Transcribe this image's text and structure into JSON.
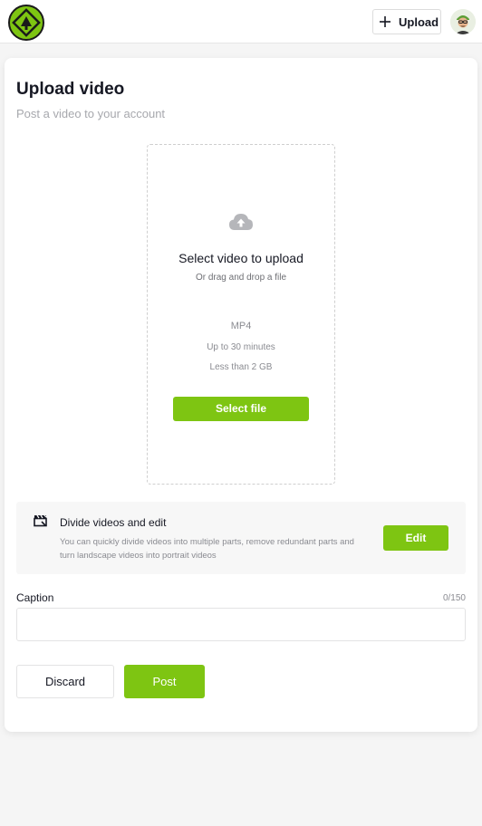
{
  "header": {
    "logo_icon": "brand-logo-icon",
    "upload_label": "Upload",
    "upload_icon": "plus-icon",
    "avatar_icon": "user-avatar"
  },
  "page": {
    "title": "Upload video",
    "subtitle": "Post a video to your account"
  },
  "dropzone": {
    "icon": "cloud-upload-icon",
    "heading": "Select video to upload",
    "subheading": "Or drag and drop a file",
    "format": "MP4",
    "duration": "Up to 30 minutes",
    "size": "Less than 2 GB",
    "button_label": "Select file"
  },
  "divide": {
    "icon": "clapperboard-icon",
    "title": "Divide videos and edit",
    "description": "You can quickly divide videos into multiple parts, remove redundant parts and turn landscape videos into portrait videos",
    "button_label": "Edit"
  },
  "caption": {
    "label": "Caption",
    "count": "0/150",
    "value": "",
    "placeholder": ""
  },
  "actions": {
    "discard_label": "Discard",
    "post_label": "Post"
  },
  "colors": {
    "accent": "#7ec512",
    "background": "#f5f5f5"
  }
}
